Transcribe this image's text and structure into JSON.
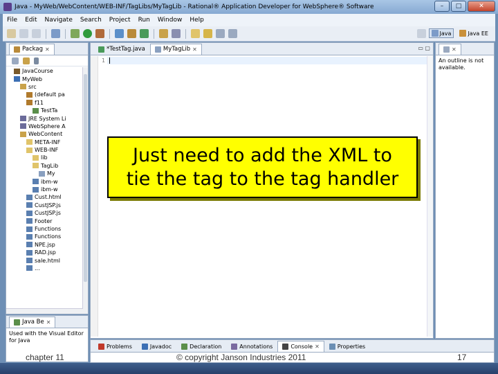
{
  "window": {
    "title": "Java - MyWeb/WebContent/WEB-INF/TagLibs/MyTagLib - Rational® Application Developer for WebSphere® Software"
  },
  "menu": [
    "File",
    "Edit",
    "Navigate",
    "Search",
    "Project",
    "Run",
    "Window",
    "Help"
  ],
  "perspectives": [
    {
      "label": "Java",
      "active": true
    },
    {
      "label": "Java EE",
      "active": false
    }
  ],
  "package_explorer": {
    "tab": "Packag",
    "items": [
      {
        "label": "JavaCourse",
        "indent": 1,
        "color": "#7a5a2a"
      },
      {
        "label": "MyWeb",
        "indent": 1,
        "color": "#3c6fb4"
      },
      {
        "label": "src",
        "indent": 2,
        "color": "#c9a24a"
      },
      {
        "label": "(default pa",
        "indent": 3,
        "color": "#b07a2c"
      },
      {
        "label": "f11",
        "indent": 3,
        "color": "#b07a2c"
      },
      {
        "label": "TestTa",
        "indent": 4,
        "color": "#5b8f4a"
      },
      {
        "label": "JRE System Li",
        "indent": 2,
        "color": "#6b6b9a"
      },
      {
        "label": "WebSphere A",
        "indent": 2,
        "color": "#6b6b9a"
      },
      {
        "label": "WebContent",
        "indent": 2,
        "color": "#c9a24a"
      },
      {
        "label": "META-INF",
        "indent": 3,
        "color": "#e0c46a"
      },
      {
        "label": "WEB-INF",
        "indent": 3,
        "color": "#e0c46a"
      },
      {
        "label": "lib",
        "indent": 4,
        "color": "#e0c46a"
      },
      {
        "label": "TagLib",
        "indent": 4,
        "color": "#e0c46a"
      },
      {
        "label": "My",
        "indent": 5,
        "color": "#8aa0c0"
      },
      {
        "label": "ibm-w",
        "indent": 4,
        "color": "#5a7fb0"
      },
      {
        "label": "ibm-w",
        "indent": 4,
        "color": "#5a7fb0"
      },
      {
        "label": "Cust.html",
        "indent": 3,
        "color": "#5a7fb0"
      },
      {
        "label": "CustJSP.js",
        "indent": 3,
        "color": "#5a7fb0"
      },
      {
        "label": "CustJSP.js",
        "indent": 3,
        "color": "#5a7fb0"
      },
      {
        "label": "Footer",
        "indent": 3,
        "color": "#5a7fb0"
      },
      {
        "label": "Functions",
        "indent": 3,
        "color": "#5a7fb0"
      },
      {
        "label": "Functions",
        "indent": 3,
        "color": "#5a7fb0"
      },
      {
        "label": "NPE.jsp",
        "indent": 3,
        "color": "#5a7fb0"
      },
      {
        "label": "RAD.jsp",
        "indent": 3,
        "color": "#5a7fb0"
      },
      {
        "label": "sale.html",
        "indent": 3,
        "color": "#5a7fb0"
      },
      {
        "label": "...",
        "indent": 3,
        "color": "#5a7fb0"
      }
    ]
  },
  "java_beans": {
    "tab": "Java Be",
    "text": "Used with the Visual Editor for Java"
  },
  "editor": {
    "tabs": [
      {
        "label": "*TestTag.java",
        "active": false
      },
      {
        "label": "MyTagLib",
        "active": true
      }
    ],
    "line_number": "1"
  },
  "outline": {
    "text": "An outline is not available."
  },
  "bottom_tabs": [
    {
      "label": "Problems",
      "color": "#c0392b"
    },
    {
      "label": "Javadoc",
      "color": "#3c6fb4"
    },
    {
      "label": "Declaration",
      "color": "#5b8f4a"
    },
    {
      "label": "Annotations",
      "color": "#7a6aa0"
    },
    {
      "label": "Console",
      "color": "#444444"
    },
    {
      "label": "Properties",
      "color": "#6b8fb4"
    }
  ],
  "callout": {
    "line1": "Just need to add the XML to",
    "line2": "tie the tag to the tag handler"
  },
  "footer": {
    "left": "chapter 11",
    "center": "© copyright Janson Industries 2011",
    "right": "17"
  }
}
